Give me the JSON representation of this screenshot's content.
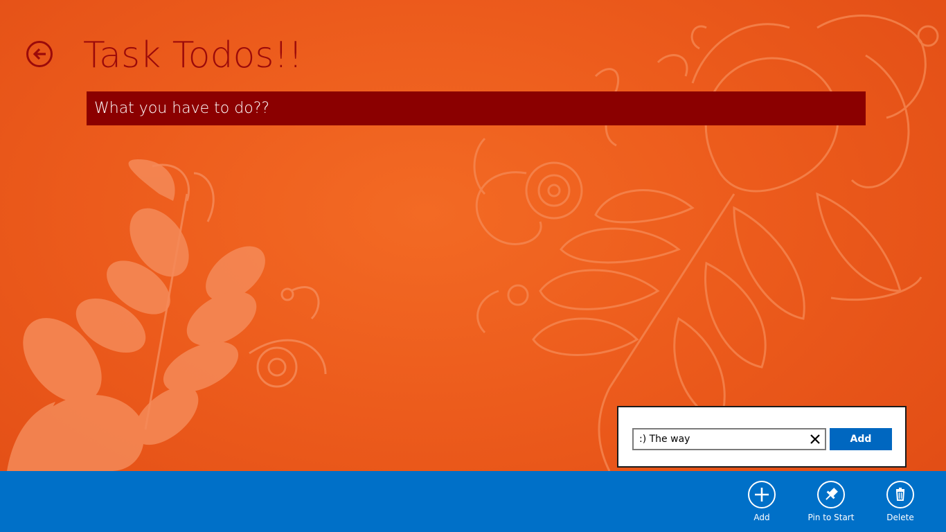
{
  "page": {
    "title": "Task Todos!!"
  },
  "task_header": {
    "label": "What you have to do??"
  },
  "flyout": {
    "input_value": ":) The way",
    "add_label": "Add"
  },
  "app_bar": {
    "commands": [
      {
        "label": "Add",
        "icon": "add-icon"
      },
      {
        "label": "Pin to Start",
        "icon": "pin-icon"
      },
      {
        "label": "Delete",
        "icon": "delete-icon"
      }
    ]
  },
  "colors": {
    "background": "#ec5b1c",
    "accent_dark_red": "#8b0000",
    "title_red": "#9b0a0a",
    "app_bar_blue": "#0070c8",
    "button_blue": "#0067c0"
  }
}
